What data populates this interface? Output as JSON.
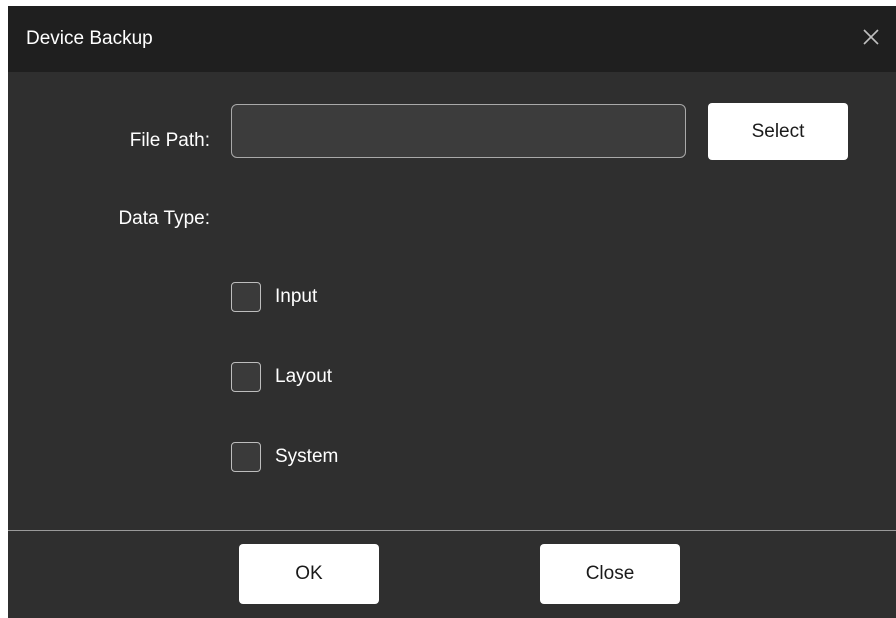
{
  "dialog": {
    "title": "Device Backup",
    "close_icon": "close-icon"
  },
  "form": {
    "file_path_label": "File Path:",
    "file_path_value": "",
    "select_label": "Select",
    "data_type_label": "Data Type:",
    "options": [
      {
        "label": "Input",
        "checked": false
      },
      {
        "label": "Layout",
        "checked": false
      },
      {
        "label": "System",
        "checked": false
      }
    ]
  },
  "footer": {
    "ok_label": "OK",
    "close_label": "Close"
  }
}
